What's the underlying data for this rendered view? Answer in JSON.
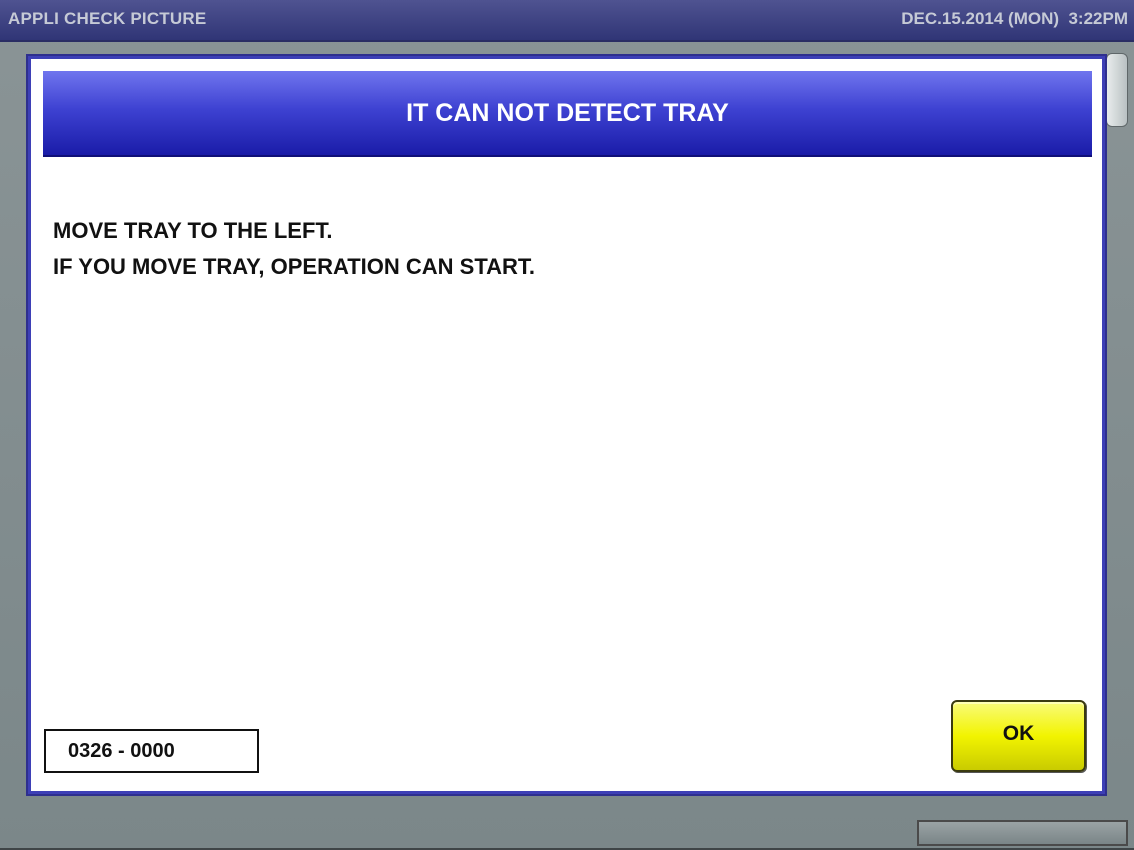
{
  "titlebar": {
    "app_title": "APPLI CHECK PICTURE",
    "datetime": "DEC.15.2014 (MON)  3:22PM"
  },
  "dialog": {
    "title": "IT CAN NOT DETECT TRAY",
    "message_lines": [
      "MOVE TRAY TO THE LEFT.",
      "IF YOU MOVE TRAY, OPERATION CAN START."
    ],
    "code": "0326 - 0000",
    "ok_label": "OK"
  },
  "colors": {
    "titlebar": "#3a3f82",
    "dialog_header": "#3e42d2",
    "dialog_border": "#3d3fb6",
    "ok_button": "#f2f400",
    "background": "#7f8b8d"
  }
}
